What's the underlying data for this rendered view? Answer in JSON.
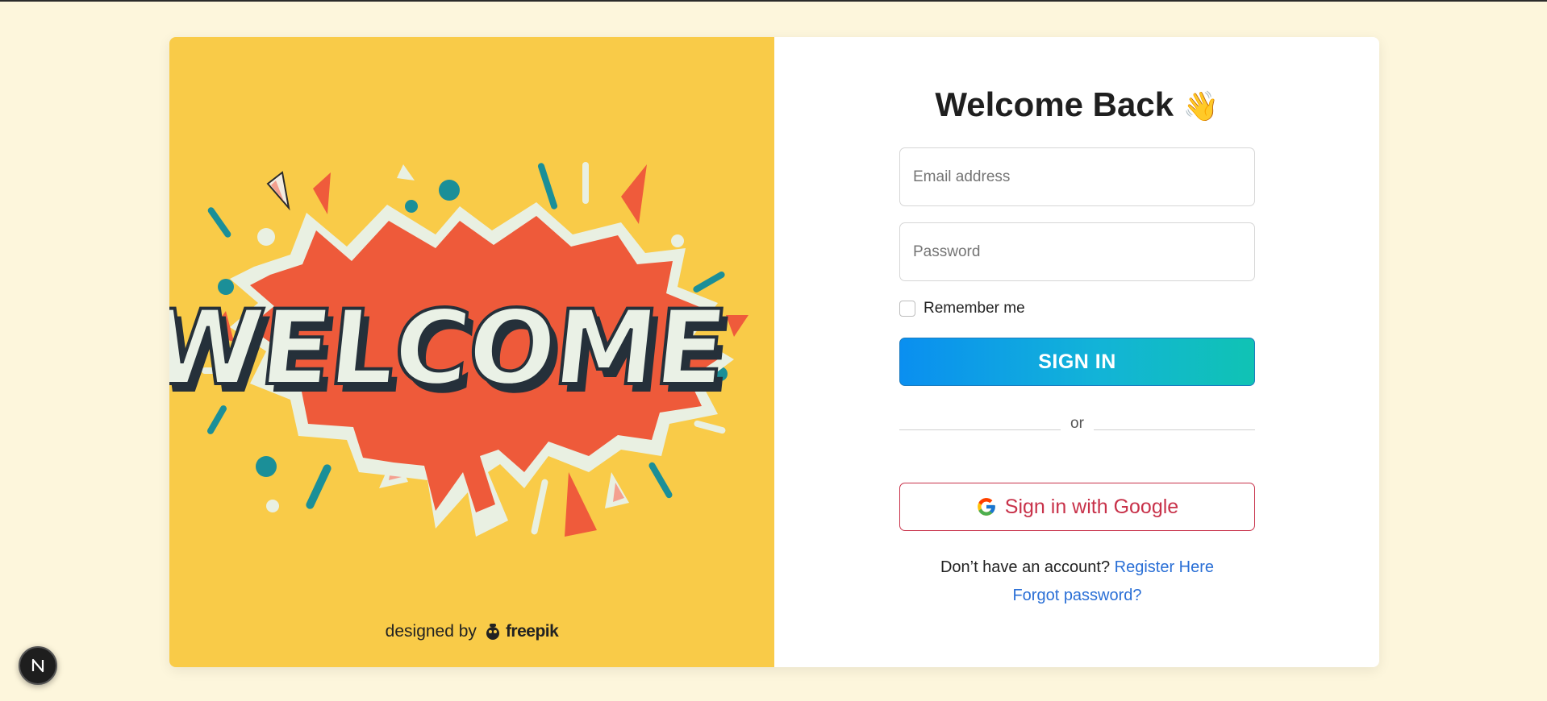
{
  "illustration": {
    "word": "WELCOME",
    "credit_prefix": "designed by",
    "credit_brand": "freepik"
  },
  "form": {
    "title": "Welcome Back",
    "title_emoji": "👋",
    "email_placeholder": "Email address",
    "password_placeholder": "Password",
    "remember_label": "Remember me",
    "signin_label": "SIGN IN",
    "divider_text": "or",
    "google_label": "Sign in with Google",
    "register_prompt": "Don’t have an account?",
    "register_link": "Register Here",
    "forgot_link": "Forgot password?"
  },
  "badge": {
    "letter": "N"
  },
  "colors": {
    "page_bg": "#fdf6dc",
    "illustration_bg": "#f9cb48",
    "accent_blue": "#0a8ff0",
    "accent_teal": "#10c3b4",
    "google_red": "#c8324a",
    "link_blue": "#2a6fd6"
  }
}
